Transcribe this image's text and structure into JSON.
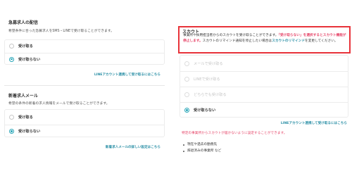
{
  "left": {
    "urgent": {
      "title": "急募求人の配信",
      "desc": "希望条件に合った急募求人をSMS・LINEで受け取ることができます。",
      "options": [
        "受け取る",
        "受け取らない"
      ],
      "selected": "受け取らない",
      "link": "LINEアカウント連携して受け取るにはこちら"
    },
    "newjob": {
      "title": "新着求人メール",
      "desc": "希望の条件の新着の求人情報をメールで受け取ることができます。",
      "options": [
        "受け取る",
        "受け取らない"
      ],
      "selected": "受け取らない",
      "link": "新着求人メールの詳しい設定はこちら"
    }
  },
  "scout": {
    "title": "スカウト",
    "text_1": "事業所や採用担当者からのスカウトを受け取ることができます。",
    "text_hl": "「受け取らない」を選択するとスカウト機能が停止します。",
    "text_2": "スカウトのリマインド通知を停止したい場合は",
    "text_link": "スカウトのリマインド",
    "text_3": "を変更してください。",
    "options": [
      {
        "label": "メールで受け取る",
        "state": "disabled"
      },
      {
        "label": "LINEで受け取る",
        "state": "disabled"
      },
      {
        "label": "どちらでも受け取る",
        "state": "disabled"
      },
      {
        "label": "受け取らない",
        "state": "checked"
      }
    ],
    "link": "LINEアカウント連携して受け取るにはこちら",
    "note": "特定の事業所からスカウトが届かないように設定することができます。",
    "bullets": [
      "現在や過去の勤務先",
      "辞退済みの事業所 など"
    ]
  },
  "colors": {
    "accent": "#2aa6b8",
    "link": "#2a8fa6",
    "highlight": "#e6476a",
    "frame": "#e8333a"
  }
}
